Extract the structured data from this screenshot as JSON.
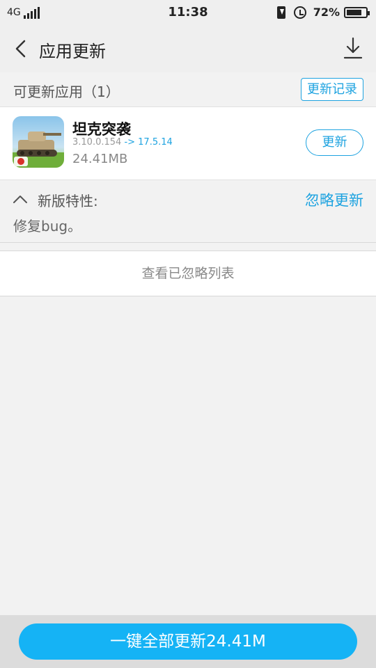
{
  "status_bar": {
    "network": "4G",
    "time": "11:38",
    "battery_text": "72%"
  },
  "header": {
    "title": "应用更新",
    "icons": [
      "back-icon",
      "download-icon"
    ]
  },
  "section": {
    "title": "可更新应用（1）",
    "history_label": "更新记录"
  },
  "apps": [
    {
      "name": "坦克突袭",
      "current_version": "3.10.0.154",
      "arrow_new_version": "-> 17.5.14",
      "size": "24.41MB",
      "update_label": "更新"
    }
  ],
  "features": {
    "label": "新版特性:",
    "ignore_label": "忽略更新",
    "text": "修复bug。"
  },
  "ignored_list_label": "查看已忽略列表",
  "update_all_label": "一键全部更新24.41M",
  "colors": {
    "accent": "#1ea3e0",
    "update_all_bg": "#15b3f5",
    "background": "#f2f2f2"
  }
}
